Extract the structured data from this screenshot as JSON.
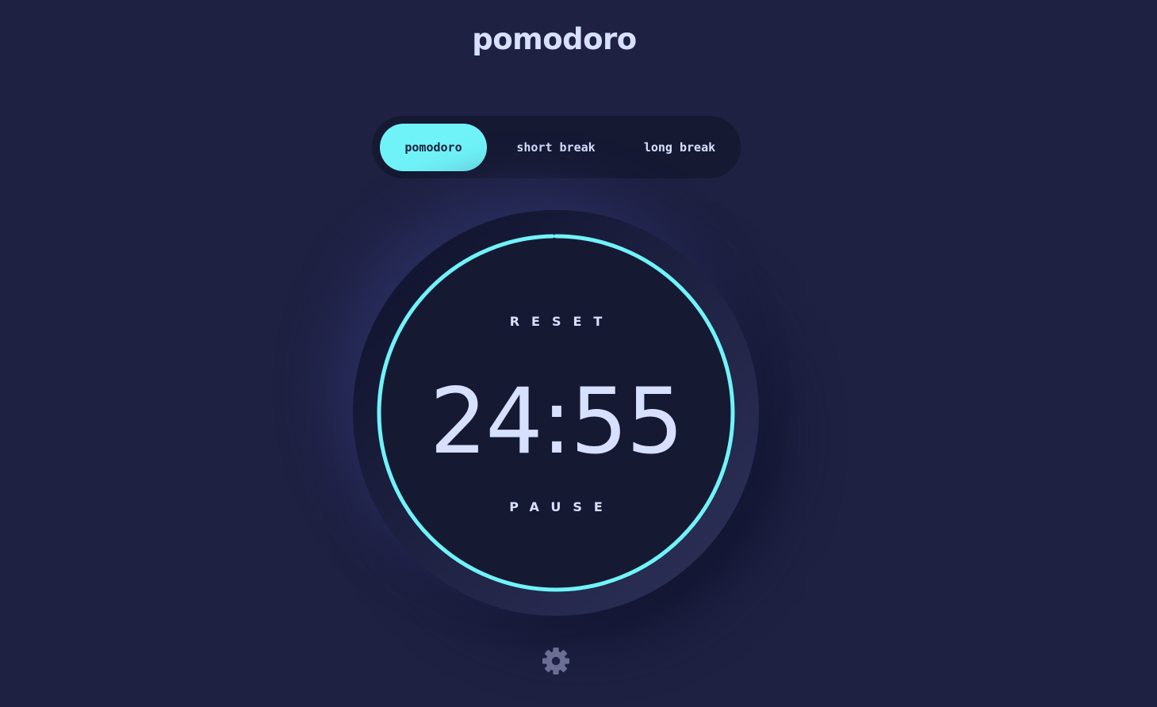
{
  "app": {
    "title": "pomodoro"
  },
  "modes": {
    "items": [
      {
        "label": "pomodoro",
        "active": true
      },
      {
        "label": "short break",
        "active": false
      },
      {
        "label": "long break",
        "active": false
      }
    ]
  },
  "timer": {
    "time": "24:55",
    "reset_label": "RESET",
    "pause_label": "PAUSE",
    "progress_fraction": 0.9967
  },
  "icons": {
    "settings": "gear-icon"
  },
  "colors": {
    "background": "#1f2143",
    "panel": "#161932",
    "accent": "#70f3f8",
    "text": "#d7e0ff",
    "icon": "#6a6e93"
  }
}
